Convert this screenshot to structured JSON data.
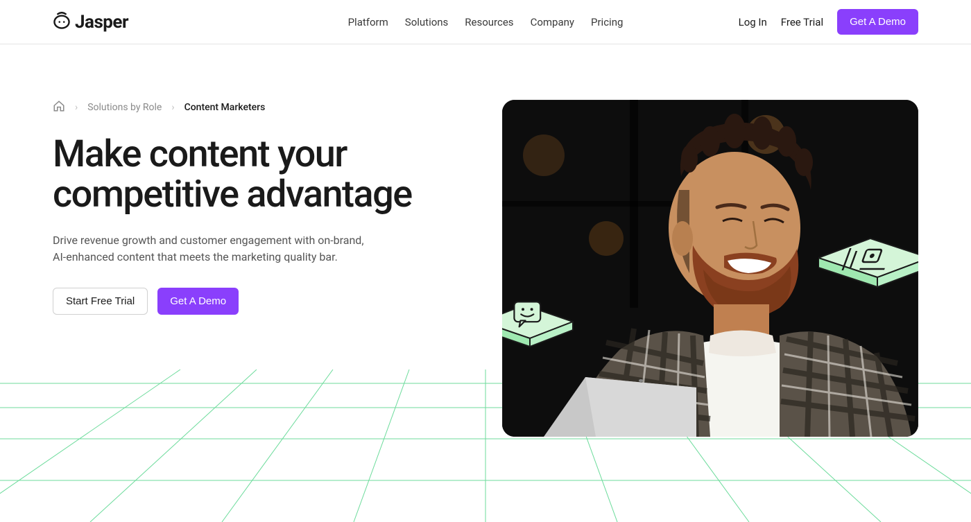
{
  "header": {
    "logo_text": "Jasper",
    "nav": [
      "Platform",
      "Solutions",
      "Resources",
      "Company",
      "Pricing"
    ],
    "login": "Log In",
    "free_trial": "Free Trial",
    "get_demo": "Get A Demo"
  },
  "breadcrumb": {
    "parent": "Solutions by Role",
    "current": "Content Marketers"
  },
  "hero": {
    "title": "Make content your competitive advantage",
    "subtitle": "Drive revenue growth and customer engagement with on-brand, AI-enhanced content that meets the marketing quality bar.",
    "cta_trial": "Start Free Trial",
    "cta_demo": "Get A Demo"
  },
  "colors": {
    "accent": "#8A3FFC",
    "badge_fill": "#D4F5D8",
    "grid": "#2ecc71"
  }
}
